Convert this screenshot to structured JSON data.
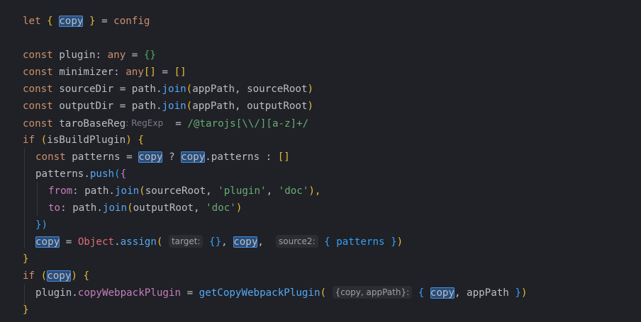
{
  "editor": {
    "theme": {
      "background": "#1f2126",
      "keyword": "#cf8e6d",
      "function": "#56a8f5",
      "string": "#6aab73",
      "property": "#c77dbb",
      "identifier_highlight": "#284d7a"
    },
    "code": {
      "l1": {
        "kw": "let",
        "open": "{",
        "copy": "copy",
        "close": "}",
        "eq": "=",
        "rhs": "config"
      },
      "l3": {
        "kw": "const",
        "name": "plugin:",
        "type": "any",
        "eq": "=",
        "val": "{}"
      },
      "l4": {
        "kw": "const",
        "name": "minimizer:",
        "type": "any",
        "arr": "[]",
        "eq": "=",
        "val": "[]"
      },
      "l5": {
        "kw": "const",
        "name": "sourceDir",
        "eq": "=",
        "obj": "path.",
        "fn": "join",
        "open": "(",
        "args": "appPath, sourceRoot",
        "close": ")"
      },
      "l6": {
        "kw": "const",
        "name": "outputDir",
        "eq": "=",
        "obj": "path.",
        "fn": "join",
        "open": "(",
        "args": "appPath, outputRoot",
        "close": ")"
      },
      "l7": {
        "kw": "const",
        "name": "taroBaseReg",
        "type_hint": ": RegExp",
        "eq": "=",
        "regex": "/@tarojs[\\\\/][a-z]+/"
      },
      "l8": {
        "kw": "if",
        "open": "(",
        "cond": "isBuildPlugin",
        "close": ")",
        "brace": "{"
      },
      "l9": {
        "kw": "const",
        "name": "patterns",
        "eq": "=",
        "copy1": "copy",
        "q": "?",
        "copy2": "copy",
        "rest": ".patterns :",
        "arr": "[]"
      },
      "l10": {
        "obj": "patterns.",
        "fn": "push",
        "open": "(",
        "brace": "{"
      },
      "l11": {
        "key": "from",
        "colon": ":",
        "obj": "path.",
        "fn": "join",
        "open": "(",
        "arg1": "sourceRoot,",
        "s1": "'plugin'",
        "comma": ",",
        "s2": "'doc'",
        "close": "),"
      },
      "l12": {
        "key": "to",
        "colon": ":",
        "obj": "path.",
        "fn": "join",
        "open": "(",
        "arg1": "outputRoot,",
        "s1": "'doc'",
        "close": ")"
      },
      "l13": {
        "close": "})"
      },
      "l14": {
        "copy": "copy",
        "eq": "=",
        "cls": "Object",
        "dot": ".",
        "fn": "assign",
        "open": "(",
        "hint1": "target:",
        "obj": "{}",
        "comma": ",",
        "copy2": "copy",
        "comma2": ",",
        "hint2": "source2:",
        "obj2": "{ patterns }",
        "close": ")"
      },
      "l15": {
        "close": "}"
      },
      "l16": {
        "kw": "if",
        "open": "(",
        "copy": "copy",
        "close": ")",
        "brace": "{"
      },
      "l17": {
        "obj": "plugin.",
        "prop": "copyWebpackPlugin",
        "eq": "=",
        "fn": "getCopyWebpackPlugin",
        "open": "(",
        "hint": "{copy, appPath}:",
        "ob": "{",
        "copy": "copy",
        "rest": ", appPath",
        "cb": "}",
        "close": ")"
      },
      "l18": {
        "close": "}"
      }
    }
  }
}
